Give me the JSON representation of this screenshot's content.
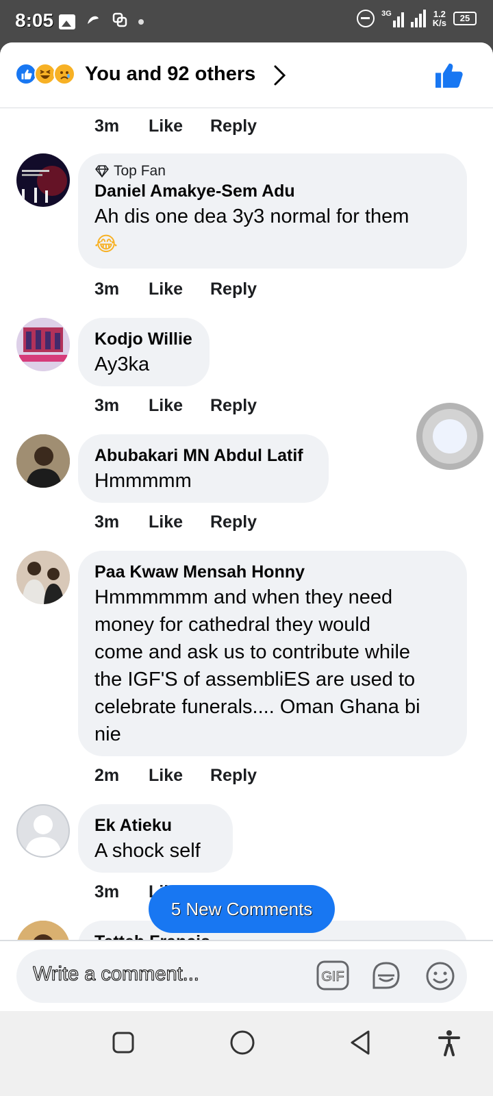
{
  "status_bar": {
    "time": "8:05",
    "network_speed_top": "1.2",
    "network_speed_bottom": "K/s",
    "network_type": "3G",
    "battery": "25"
  },
  "header": {
    "reaction_summary": "You and 92 others"
  },
  "comments": [
    {
      "author": "Daniel Amakye-Sem Adu",
      "badge": "Top Fan",
      "text": "Ah dis one dea 3y3 normal for them",
      "emoji": "😂",
      "time": "3m"
    },
    {
      "author": "Kodjo Willie",
      "text": "Ay3ka",
      "time": "3m"
    },
    {
      "author": "Abubakari MN Abdul Latif",
      "text": "Hmmmmm",
      "time": "3m"
    },
    {
      "author": "Paa Kwaw Mensah Honny",
      "text_lines": [
        "Hmmmmmm and when they need",
        "money for cathedral they would",
        "come and ask us to contribute while",
        "the IGF'S of assembliES are used to",
        "celebrate funerals.... Oman Ghana bi",
        "nie"
      ],
      "time": "2m"
    },
    {
      "author": "Ek Atieku",
      "text": "A shock self",
      "time": "3m"
    },
    {
      "author": "Tetteh Francis",
      "text": ""
    }
  ],
  "previous_comment_time": "3m",
  "actions": {
    "like": "Like",
    "reply": "Reply"
  },
  "new_comments_button": "5 New Comments",
  "composer": {
    "placeholder": "Write a comment...",
    "gif_label": "GIF"
  },
  "colors": {
    "accent": "#1877f2",
    "bubble": "#f0f2f5",
    "text": "#050505"
  }
}
